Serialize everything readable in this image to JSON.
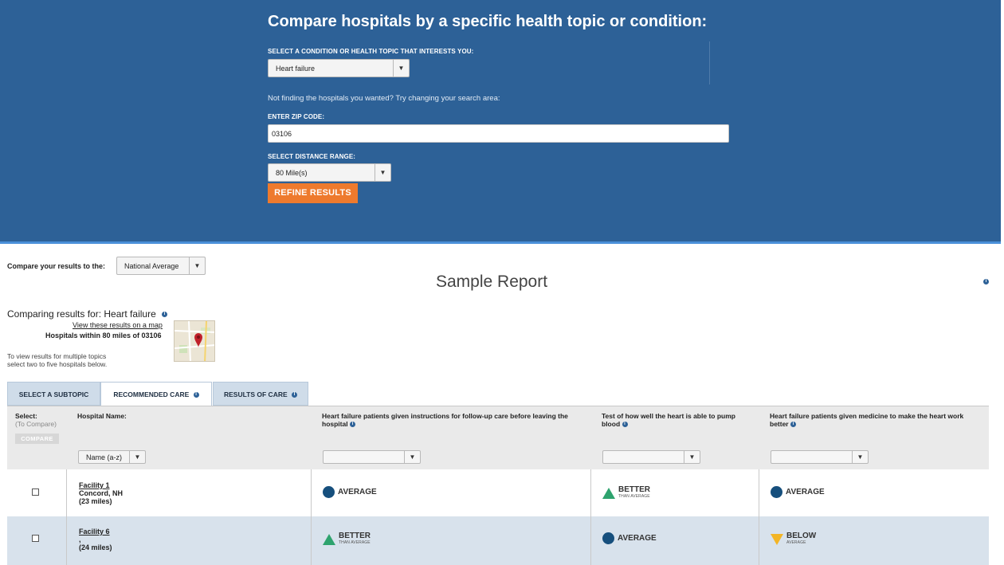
{
  "hero": {
    "title": "Compare hospitals by a specific health topic or condition:",
    "condition_label": "SELECT A CONDITION OR HEALTH TOPIC THAT INTERESTS YOU:",
    "condition_value": "Heart failure",
    "hint": "Not finding the hospitals you wanted? Try changing your search area:",
    "zip_label": "ENTER ZIP CODE:",
    "zip_value": "03106",
    "distance_label": "SELECT DISTANCE RANGE:",
    "distance_value": "80 Mile(s)",
    "refine_label": "REFINE RESULTS"
  },
  "compare": {
    "label": "Compare your results to the:",
    "value": "National Average"
  },
  "report_title": "Sample Report",
  "results": {
    "comparing": "Comparing results for: Heart failure",
    "view_map": "View these results on a map",
    "within": "Hospitals within 80 miles of 03106",
    "multi_line1": "To view results for multiple topics",
    "multi_line2": "select two to five hospitals below."
  },
  "tabs": [
    {
      "label": "SELECT A SUBTOPIC"
    },
    {
      "label": "RECOMMENDED CARE"
    },
    {
      "label": "RESULTS OF CARE"
    }
  ],
  "table": {
    "select_label": "Select:",
    "select_sub": "(To Compare)",
    "compare_button": "COMPARE",
    "name_header": "Hospital Name:",
    "sort_value": "Name (a-z)",
    "col1_header": "Heart failure patients given instructions for follow-up care before leaving the hospital",
    "col2_header": "Test of how well the heart is able to pump blood",
    "col3_header": "Heart failure patients given medicine to make the heart work better",
    "rows": [
      {
        "name": "Facility 1",
        "location": "Concord, NH",
        "distance": "(23 miles)",
        "col1": {
          "label": "AVERAGE",
          "sub": ""
        },
        "col2": {
          "label": "BETTER",
          "sub": "THAN AVERAGE"
        },
        "col3": {
          "label": "AVERAGE",
          "sub": ""
        }
      },
      {
        "name": "Facility 6",
        "location": ",",
        "distance": "(24 miles)",
        "col1": {
          "label": "BETTER",
          "sub": "THAN AVERAGE"
        },
        "col2": {
          "label": "AVERAGE",
          "sub": ""
        },
        "col3": {
          "label": "BELOW",
          "sub": "AVERAGE"
        }
      }
    ]
  },
  "colors": {
    "header_bg": "#2d6197",
    "accent_orange": "#ee7a2d",
    "average": "#164f7d",
    "better": "#2ea36e",
    "below": "#f3b526"
  }
}
